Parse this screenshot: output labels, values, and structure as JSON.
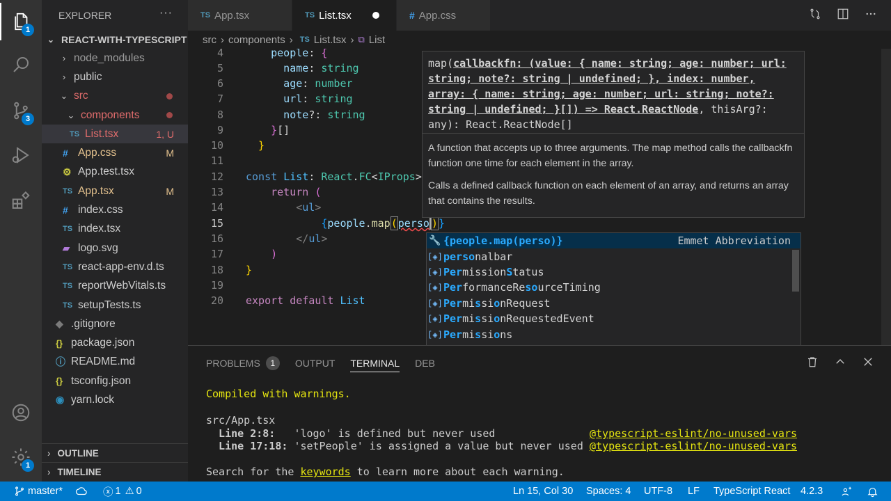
{
  "colors": {
    "accent": "#007acc",
    "status_bar": "#007acc",
    "editor_bg": "#1e1e1e",
    "sidebar_bg": "#252526"
  },
  "activity": {
    "explorer_badge": "1",
    "scm_badge": "3",
    "settings_badge": "1"
  },
  "explorer": {
    "title": "EXPLORER",
    "more": "···",
    "root": "REACT-WITH-TYPESCRIPT",
    "items": [
      {
        "label": "node_modules",
        "icon": "",
        "status": ""
      },
      {
        "label": "public",
        "icon": "",
        "status": ""
      },
      {
        "label": "src",
        "icon": "",
        "status": ""
      },
      {
        "label": "components",
        "icon": "",
        "status": ""
      },
      {
        "label": "List.tsx",
        "icon": "TS",
        "status": "1, U"
      },
      {
        "label": "App.css",
        "icon": "#",
        "status": "M"
      },
      {
        "label": "App.test.tsx",
        "icon": "",
        "status": ""
      },
      {
        "label": "App.tsx",
        "icon": "TS",
        "status": "M"
      },
      {
        "label": "index.css",
        "icon": "#",
        "status": ""
      },
      {
        "label": "index.tsx",
        "icon": "TS",
        "status": ""
      },
      {
        "label": "logo.svg",
        "icon": "",
        "status": ""
      },
      {
        "label": "react-app-env.d.ts",
        "icon": "TS",
        "status": ""
      },
      {
        "label": "reportWebVitals.ts",
        "icon": "TS",
        "status": ""
      },
      {
        "label": "setupTests.ts",
        "icon": "TS",
        "status": ""
      },
      {
        "label": ".gitignore",
        "icon": "",
        "status": ""
      },
      {
        "label": "package.json",
        "icon": "{}",
        "status": ""
      },
      {
        "label": "README.md",
        "icon": "",
        "status": ""
      },
      {
        "label": "tsconfig.json",
        "icon": "{}",
        "status": ""
      },
      {
        "label": "yarn.lock",
        "icon": "",
        "status": ""
      }
    ],
    "outline": "OUTLINE",
    "timeline": "TIMELINE"
  },
  "tabs": [
    {
      "icon": "TS",
      "label": "App.tsx"
    },
    {
      "icon": "TS",
      "label": "List.tsx"
    },
    {
      "icon": "#",
      "label": "App.css"
    }
  ],
  "breadcrumb": {
    "part1": "src",
    "part2": "components",
    "part3": "List.tsx",
    "part4": "List",
    "sep": "›"
  },
  "editor": {
    "lines": [
      "4",
      "5",
      "6",
      "7",
      "8",
      "9",
      "10",
      "11",
      "12",
      "13",
      "14",
      "15",
      "16",
      "17",
      "18",
      "19",
      "20"
    ]
  },
  "hover": {
    "sig_prefix": "map(",
    "sig_param": "callbackfn: (value: { name: string; age: number; url: string; note?: string | undefined; }, index: number, array: { name: string; age: number; url: string; note?: string | undefined; }[]) => React.ReactNode",
    "sig_suffix": ", thisArg?: any): React.ReactNode[]",
    "doc1": "A function that accepts up to three arguments. The map method calls the callbackfn function one time for each element in the array.",
    "doc2": "Calls a defined callback function on each element of an array, and returns an array that contains the results."
  },
  "suggest": {
    "first": "{people.map(perso)}",
    "first_detail": "Emmet Abbreviation"
  },
  "panel": {
    "tabs": [
      "PROBLEMS",
      "OUTPUT",
      "TERMINAL",
      "DEB"
    ],
    "problems_count": "1",
    "t1": "Compiled with warnings.",
    "t2": "src/App.tsx",
    "t3a": "  Line 2:8:   ",
    "t3b": "'logo' is defined but never used",
    "t3c": "@typescript-eslint/no-unused-vars",
    "t4a": "  Line 17:18: ",
    "t4b": "'setPeople' is assigned a value but never used",
    "t4c": "@typescript-eslint/no-unused-vars",
    "t5a": "Search for the ",
    "t5b": "keywords",
    "t5c": " to learn more about each warning."
  },
  "status": {
    "branch": "master*",
    "errors": "1",
    "warnings": "0",
    "position": "Ln 15, Col 30",
    "spaces": "Spaces: 4",
    "encoding": "UTF-8",
    "eol": "LF",
    "language": "TypeScript React",
    "version": "4.2.3"
  }
}
